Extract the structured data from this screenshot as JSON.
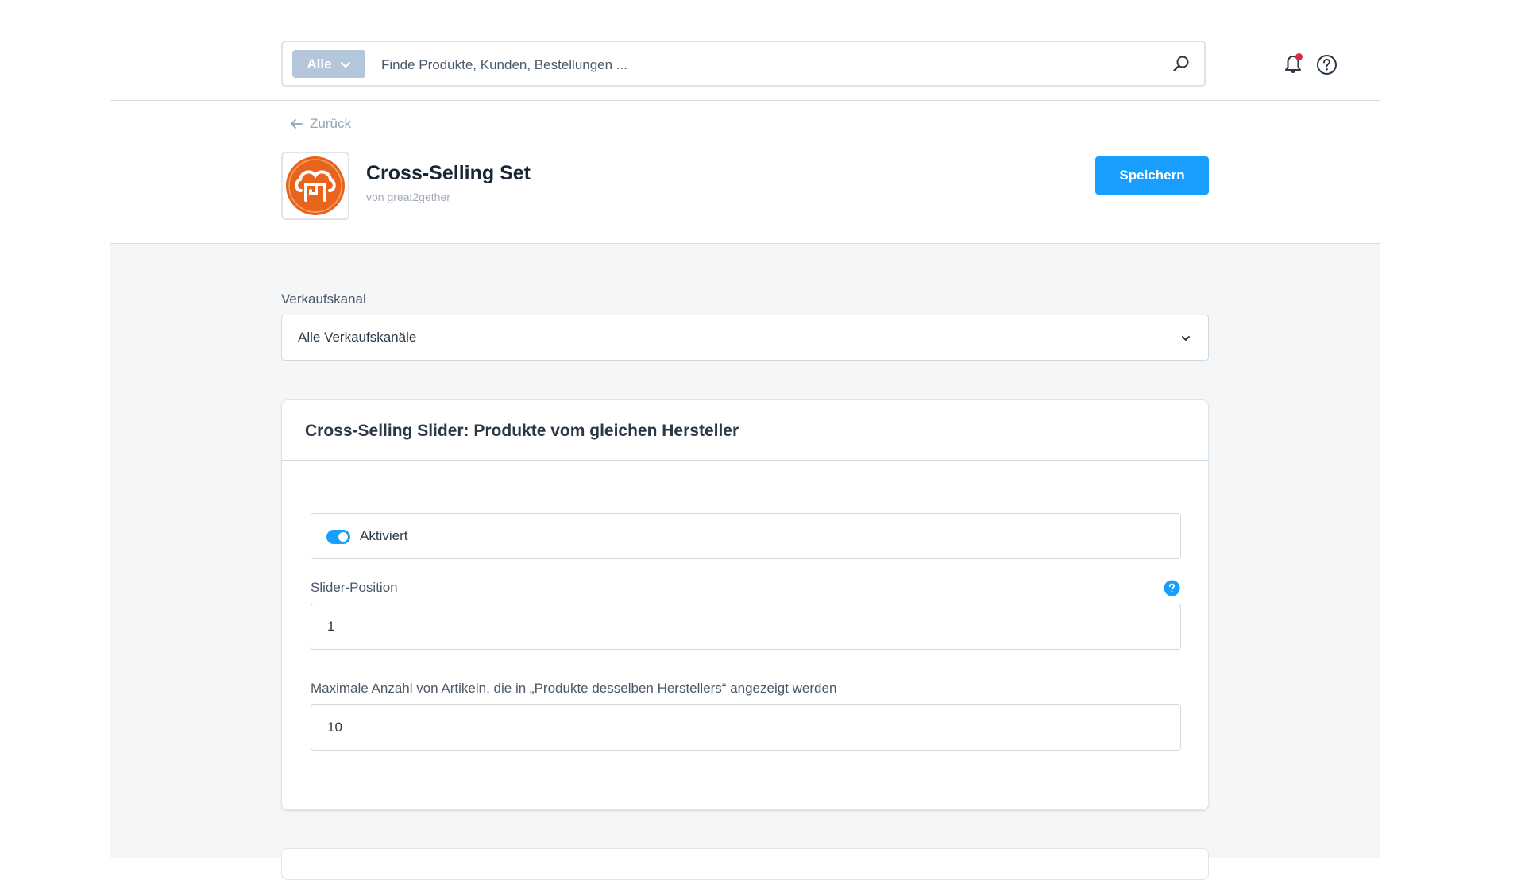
{
  "search": {
    "type_label": "Alle",
    "placeholder": "Finde Produkte, Kunden, Bestellungen ..."
  },
  "header": {
    "back_label": "Zurück",
    "app_title": "Cross-Selling Set",
    "app_vendor": "von great2gether",
    "save_label": "Speichern"
  },
  "sales_channel": {
    "label": "Verkaufskanal",
    "value": "Alle Verkaufskanäle"
  },
  "card": {
    "title": "Cross-Selling Slider: Produkte vom gleichen Hersteller",
    "toggle": {
      "label": "Aktiviert",
      "checked": true
    },
    "slider_position": {
      "label": "Slider-Position",
      "value": "1"
    },
    "max_items": {
      "label": "Maximale Anzahl von Artikeln, die in „Produkte desselben Herstellers“ angezeigt werden",
      "value": "10"
    }
  },
  "colors": {
    "accent": "#189eff",
    "logo_orange": "#e8641d",
    "notification_dot": "#de294c"
  },
  "icons": [
    "search-icon",
    "bell-icon",
    "help-icon",
    "arrow-left-icon",
    "chevron-down-icon",
    "info-icon",
    "app-logo-icon"
  ]
}
